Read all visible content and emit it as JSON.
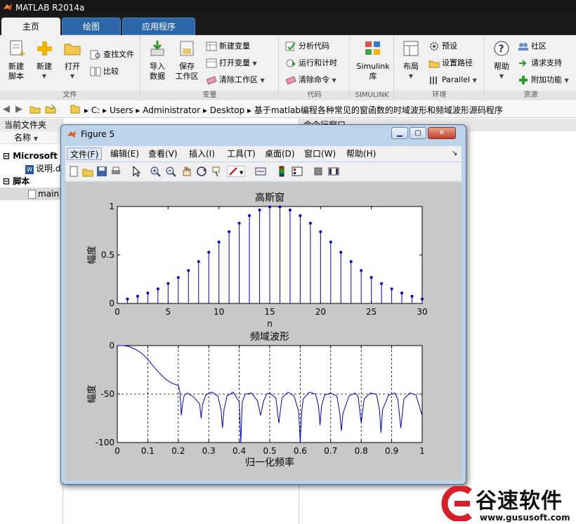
{
  "app": {
    "title": "MATLAB R2014a"
  },
  "ribbon": {
    "tabs": [
      "主页",
      "绘图",
      "应用程序"
    ],
    "groups": {
      "file": {
        "label": "文件",
        "new_script": "新建\n脚本",
        "new": "新建",
        "open": "打开",
        "find_files": "查找文件",
        "compare": "比较"
      },
      "variable": {
        "label": "变量",
        "import": "导入\n数据",
        "save_ws": "保存\n工作区",
        "new_var": "新建变量",
        "open_var": "打开变量",
        "clear_ws": "清除工作区"
      },
      "code": {
        "label": "代码",
        "analyze": "分析代码",
        "run_time": "运行和计时",
        "clear_cmd": "清除命令"
      },
      "simulink": {
        "label": "SIMULINK",
        "lib": "Simulink\n库"
      },
      "env": {
        "label": "环境",
        "layout": "布局",
        "prefs": "预设",
        "set_path": "设置路径",
        "parallel": "Parallel"
      },
      "resources": {
        "label": "资源",
        "help": "帮助",
        "community": "社区",
        "support": "请求支持",
        "addons": "附加功能"
      }
    }
  },
  "address": {
    "parts": [
      "C:",
      "Users",
      "Administrator",
      "Desktop",
      "基于matlab编程各种常见的窗函数的时域波形和频域波形源码程序"
    ]
  },
  "left_panel": {
    "title": "当前文件夹",
    "col_name": "名称",
    "items": [
      {
        "label": "Microsoft O",
        "bold": true
      },
      {
        "label": "说明.d",
        "bold": false
      },
      {
        "label": "脚本",
        "bold": true
      },
      {
        "label": "main",
        "bold": false
      }
    ]
  },
  "right_panel": {
    "title": "命令行窗口"
  },
  "figure": {
    "title": "Figure 5",
    "menu": [
      "文件(F)",
      "编辑(E)",
      "查看(V)",
      "插入(I)",
      "工具(T)",
      "桌面(D)",
      "窗口(W)",
      "帮助(H)"
    ]
  },
  "watermark": {
    "brand": "谷速软件",
    "url": "www.gususoft.com"
  },
  "colors": {
    "accent": "#2a66a8",
    "plot_line": "#0000cc",
    "figure_bg": "#c8c8c8"
  },
  "chart_data": [
    {
      "type": "stem",
      "title": "高斯窗",
      "xlabel": "n",
      "ylabel": "幅度",
      "xlim": [
        0,
        30
      ],
      "ylim": [
        0,
        1
      ],
      "xticks": [
        0,
        5,
        10,
        15,
        20,
        25,
        30
      ],
      "yticks": [
        0,
        0.5,
        1
      ],
      "x": [
        1,
        2,
        3,
        4,
        5,
        6,
        7,
        8,
        9,
        10,
        11,
        12,
        13,
        14,
        15,
        16,
        17,
        18,
        19,
        20,
        21,
        22,
        23,
        24,
        25,
        26,
        27,
        28,
        29,
        30
      ],
      "values": [
        0.046,
        0.074,
        0.108,
        0.15,
        0.206,
        0.268,
        0.34,
        0.432,
        0.528,
        0.634,
        0.74,
        0.828,
        0.906,
        0.964,
        0.996,
        0.996,
        0.964,
        0.906,
        0.828,
        0.74,
        0.634,
        0.528,
        0.432,
        0.34,
        0.268,
        0.206,
        0.15,
        0.108,
        0.074,
        0.046
      ]
    },
    {
      "type": "line",
      "title": "频域波形",
      "xlabel": "归一化频率",
      "ylabel": "幅度",
      "xlim": [
        0,
        1
      ],
      "ylim": [
        -100,
        0
      ],
      "grid": true,
      "xticks": [
        0,
        0.1,
        0.2,
        0.3,
        0.4,
        0.5,
        0.6,
        0.7,
        0.8,
        0.9,
        1
      ],
      "yticks": [
        -100,
        -50,
        0
      ],
      "x": [
        0,
        0.02,
        0.04,
        0.06,
        0.08,
        0.1,
        0.12,
        0.14,
        0.16,
        0.18,
        0.2,
        0.205,
        0.21,
        0.215,
        0.22,
        0.23,
        0.25,
        0.27,
        0.275,
        0.28,
        0.29,
        0.31,
        0.33,
        0.34,
        0.345,
        0.35,
        0.36,
        0.38,
        0.4,
        0.405,
        0.41,
        0.42,
        0.44,
        0.46,
        0.47,
        0.48,
        0.49,
        0.5,
        0.52,
        0.53,
        0.54,
        0.56,
        0.58,
        0.595,
        0.6,
        0.605,
        0.61,
        0.63,
        0.65,
        0.66,
        0.665,
        0.67,
        0.68,
        0.7,
        0.72,
        0.73,
        0.735,
        0.74,
        0.76,
        0.78,
        0.79,
        0.8,
        0.81,
        0.83,
        0.85,
        0.86,
        0.865,
        0.87,
        0.89,
        0.91,
        0.92,
        0.93,
        0.94,
        0.96,
        0.98,
        0.99,
        1.0
      ],
      "values": [
        0,
        0,
        -1,
        -4,
        -8,
        -14,
        -22,
        -29,
        -35,
        -39,
        -41,
        -47,
        -72,
        -58,
        -51,
        -49,
        -53,
        -60,
        -75,
        -60,
        -51,
        -48,
        -52,
        -66,
        -85,
        -66,
        -52,
        -48,
        -58,
        -100,
        -58,
        -50,
        -49,
        -57,
        -72,
        -57,
        -50,
        -49,
        -54,
        -80,
        -54,
        -48,
        -52,
        -68,
        -100,
        -68,
        -55,
        -48,
        -50,
        -62,
        -82,
        -62,
        -51,
        -49,
        -52,
        -70,
        -88,
        -70,
        -52,
        -49,
        -53,
        -80,
        -55,
        -49,
        -50,
        -66,
        -90,
        -66,
        -51,
        -49,
        -55,
        -85,
        -55,
        -49,
        -51,
        -62,
        -72
      ]
    }
  ]
}
